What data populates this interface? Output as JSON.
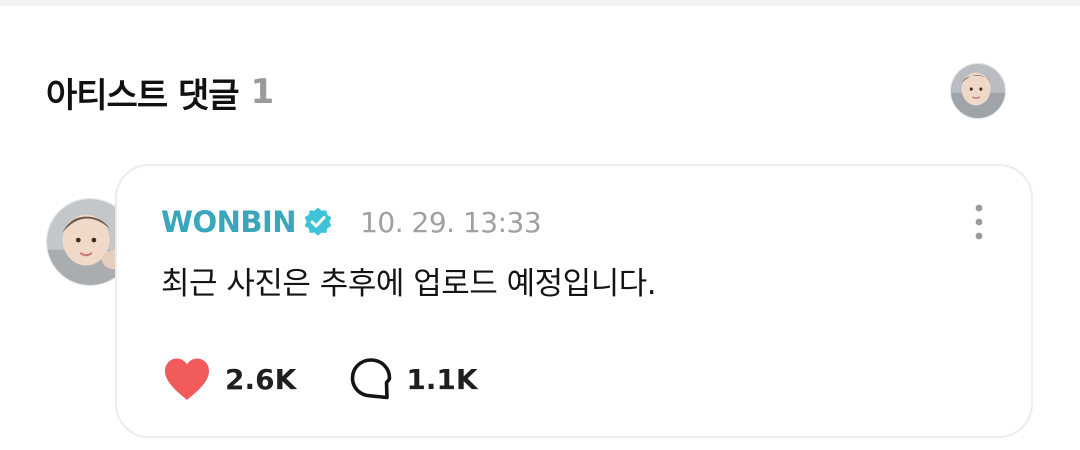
{
  "section": {
    "title": "아티스트 댓글",
    "count": "1"
  },
  "comment": {
    "author": "WONBIN",
    "verified_icon": "verified-badge-icon",
    "timestamp": "10. 29. 13:33",
    "text": "최근 사진은 추후에 업로드 예정입니다.",
    "like_count": "2.6K",
    "reply_count": "1.1K"
  },
  "icons": {
    "like": "heart-icon",
    "reply": "speech-bubble-icon",
    "more": "more-vertical-icon"
  },
  "colors": {
    "author_name": "#3aa6bd",
    "verified_badge": "#3ec4d6",
    "heart": "#f15b5b",
    "timestamp": "#a0a0a0",
    "card_border": "#ececec"
  }
}
